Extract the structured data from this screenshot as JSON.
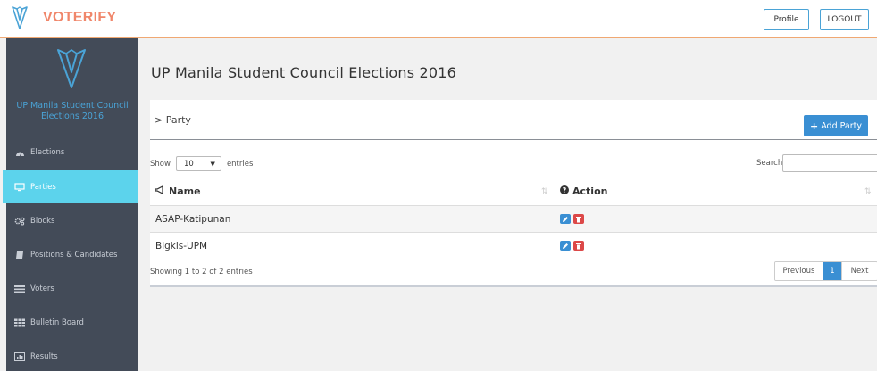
{
  "app": {
    "name": "VOTERIFY"
  },
  "header": {
    "profile_label": "Profile",
    "logout_label": "LOGOUT"
  },
  "sidebar": {
    "title": "UP Manila Student Council Elections 2016",
    "items": [
      {
        "label": "Elections",
        "icon": "dashboard-icon"
      },
      {
        "label": "Parties",
        "icon": "monitor-icon",
        "active": true
      },
      {
        "label": "Blocks",
        "icon": "cogs-icon"
      },
      {
        "label": "Positions & Candidates",
        "icon": "book-icon"
      },
      {
        "label": "Voters",
        "icon": "list-icon"
      },
      {
        "label": "Bulletin Board",
        "icon": "grid-icon"
      },
      {
        "label": "Results",
        "icon": "bar-chart-icon"
      }
    ]
  },
  "main": {
    "page_title": "UP Manila Student Council Elections 2016",
    "breadcrumb": "> Party",
    "add_button_label": "Add Party",
    "show_label": "Show",
    "length_value": "10",
    "entries_label": "entries",
    "search_label": "Search:",
    "columns": [
      "Name",
      "Action"
    ],
    "rows": [
      {
        "name": "ASAP-Katipunan"
      },
      {
        "name": "Bigkis-UPM"
      }
    ],
    "info": "Showing 1 to 2 of 2 entries",
    "pagination": {
      "previous": "Previous",
      "current": "1",
      "next": "Next"
    }
  },
  "colors": {
    "brand": "#f0866a",
    "accent": "#3a8fd3",
    "sidebar_bg": "#434b58",
    "active": "#5cd3ec",
    "danger": "#dc4848"
  }
}
